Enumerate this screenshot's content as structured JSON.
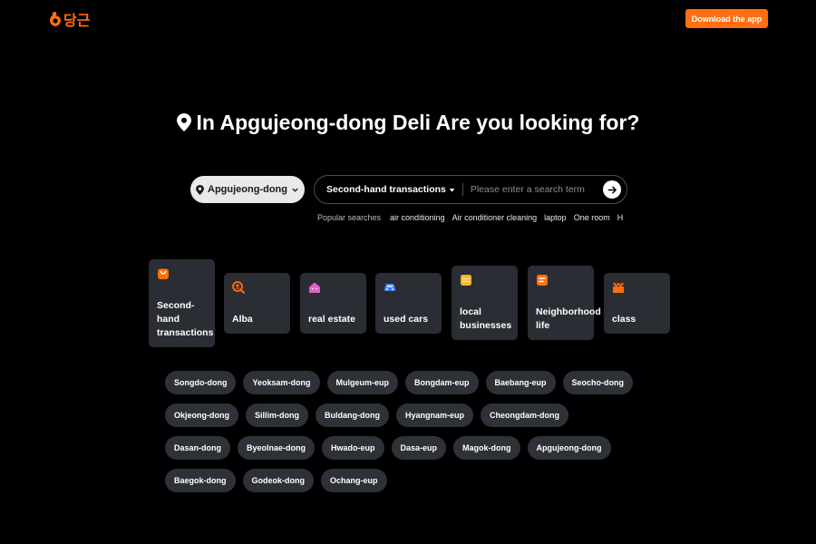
{
  "header": {
    "logo_text": "당근",
    "download_label": "Download the app",
    "brand_color": "#ff6f0f"
  },
  "hero": {
    "title": "In Apgujeong-dong Deli Are you looking for?",
    "icon": "map-pin-icon"
  },
  "search": {
    "location": "Apgujeong-dong",
    "category": "Second-hand transactions",
    "placeholder": "Please enter a search term",
    "popular_label": "Popular searches",
    "popular": [
      "air conditioning",
      "Air conditioner cleaning",
      "laptop",
      "One room",
      "H"
    ]
  },
  "categories": [
    {
      "label": "Second-hand transactions",
      "icon": "shopping-bag-icon",
      "icon_color": "#ff6f0f"
    },
    {
      "label": "Alba",
      "icon": "person-search-icon",
      "icon_color": "#ff6f0f"
    },
    {
      "label": "real estate",
      "icon": "house-icon",
      "icon_color": "#e45cc9"
    },
    {
      "label": "used cars",
      "icon": "car-icon",
      "icon_color": "#3b7cf0"
    },
    {
      "label": "local businesses",
      "icon": "store-icon",
      "icon_color": "#f5b52b"
    },
    {
      "label": "Neighborhood life",
      "icon": "notes-icon",
      "icon_color": "#ff6f0f"
    },
    {
      "label": "class",
      "icon": "class-box-icon",
      "icon_color": "#ff6f0f"
    }
  ],
  "neighborhoods": [
    "Songdo-dong",
    "Yeoksam-dong",
    "Mulgeum-eup",
    "Bongdam-eup",
    "Baebang-eup",
    "Seocho-dong",
    "Okjeong-dong",
    "Sillim-dong",
    "Buldang-dong",
    "Hyangnam-eup",
    "Cheongdam-dong",
    "Dasan-dong",
    "Byeolnae-dong",
    "Hwado-eup",
    "Dasa-eup",
    "Magok-dong",
    "Apgujeong-dong",
    "Baegok-dong",
    "Godeok-dong",
    "Ochang-eup"
  ]
}
